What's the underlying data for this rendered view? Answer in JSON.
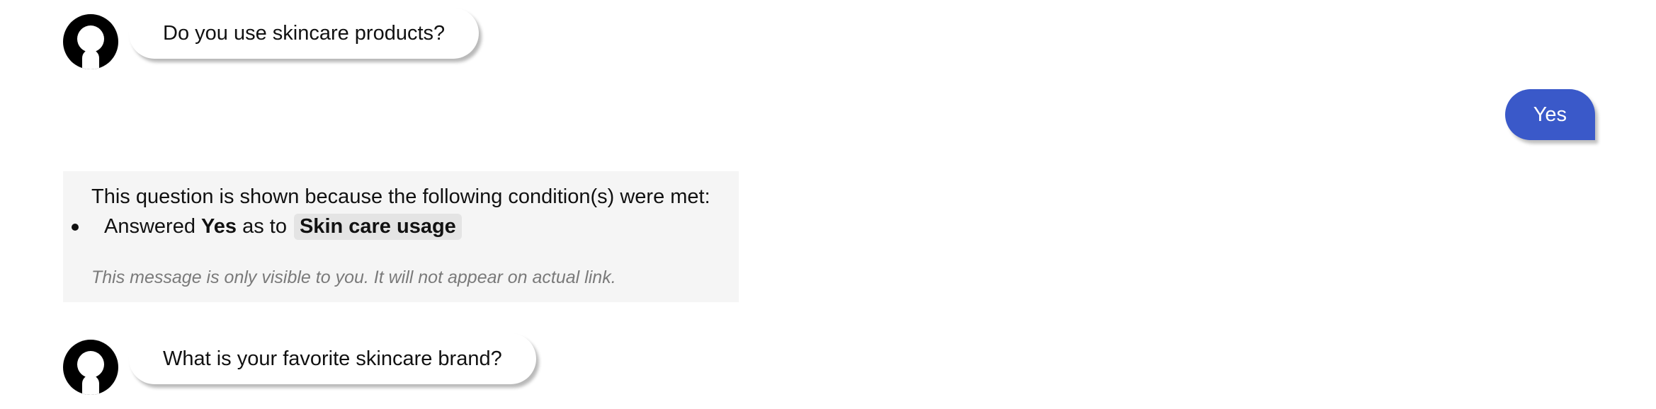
{
  "messages": {
    "bot_q1": "Do you use skincare products?",
    "user_a1": "Yes",
    "bot_q2": "What is your favorite skincare brand?"
  },
  "condition_notice": {
    "title": "This question is shown because the following condition(s) were met:",
    "condition": {
      "prefix": "Answered",
      "answer": "Yes",
      "connector": "as to",
      "question_tag": "Skin care usage"
    },
    "footnote": "This message is only visible to you. It will not appear on actual link."
  },
  "colors": {
    "user_bubble": "#3a59c9",
    "notice_background": "#f5f5f5",
    "tag_background": "#e4e4e4"
  },
  "icons": {
    "bot_avatar": "user-avatar-icon"
  }
}
